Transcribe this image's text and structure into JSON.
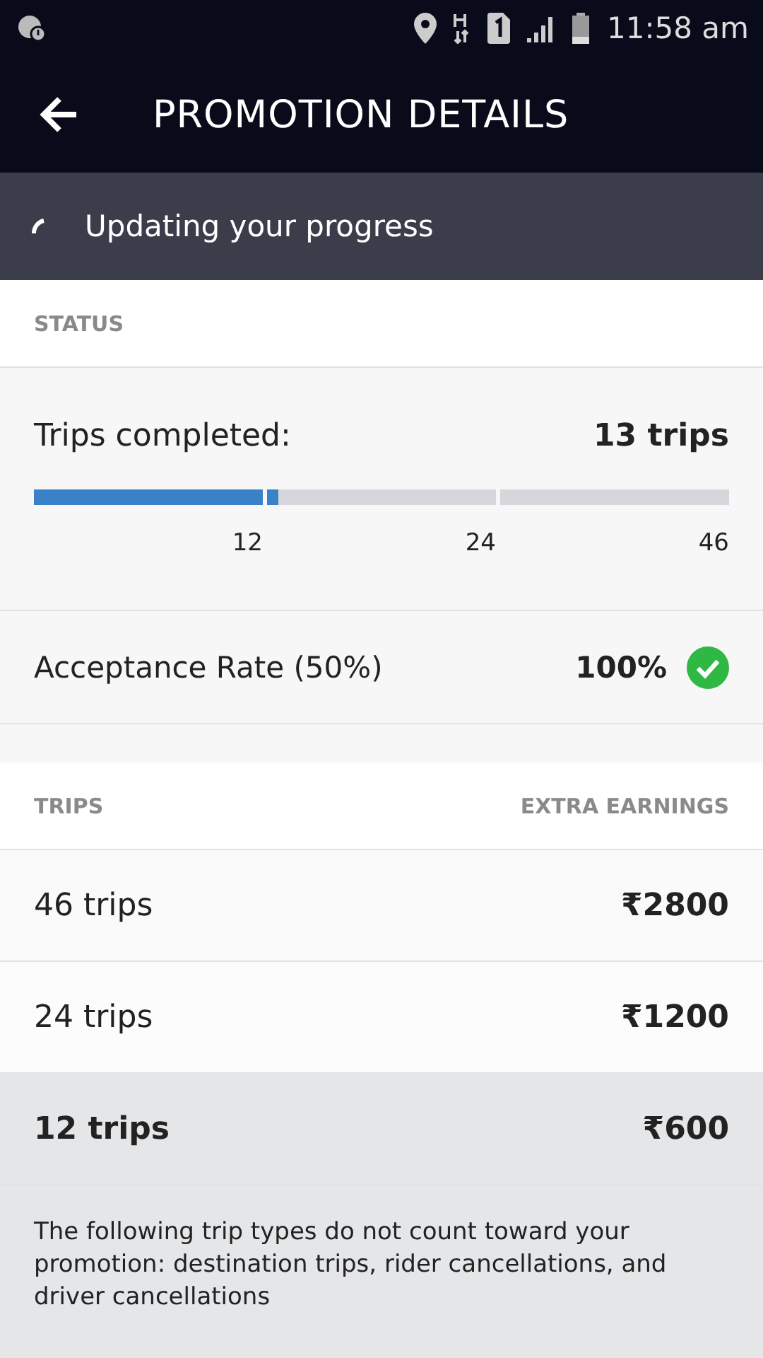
{
  "status_bar": {
    "time": "11:58 am"
  },
  "app_bar": {
    "title": "PROMOTION DETAILS"
  },
  "banner": {
    "text": "Updating your progress"
  },
  "status_section": {
    "header": "STATUS",
    "trips_label": "Trips completed:",
    "trips_value": "13 trips",
    "segments": [
      {
        "level": 1,
        "tick": "12"
      },
      {
        "level": 0.05,
        "tick": "24"
      },
      {
        "level": 0,
        "tick": "46"
      }
    ],
    "acceptance_label": "Acceptance Rate (50%)",
    "acceptance_value": "100%",
    "acceptance_met": true
  },
  "table": {
    "columns": [
      "TRIPS",
      "EXTRA EARNINGS"
    ],
    "rows": [
      {
        "trips": "46 trips",
        "earnings": "₹2800",
        "selected": false
      },
      {
        "trips": "24 trips",
        "earnings": "₹1200",
        "selected": false
      },
      {
        "trips": "12 trips",
        "earnings": "₹600",
        "selected": true
      }
    ]
  },
  "footnote": "The following trip types do not count toward your promotion: destination trips, rider cancellations, and driver cancellations"
}
